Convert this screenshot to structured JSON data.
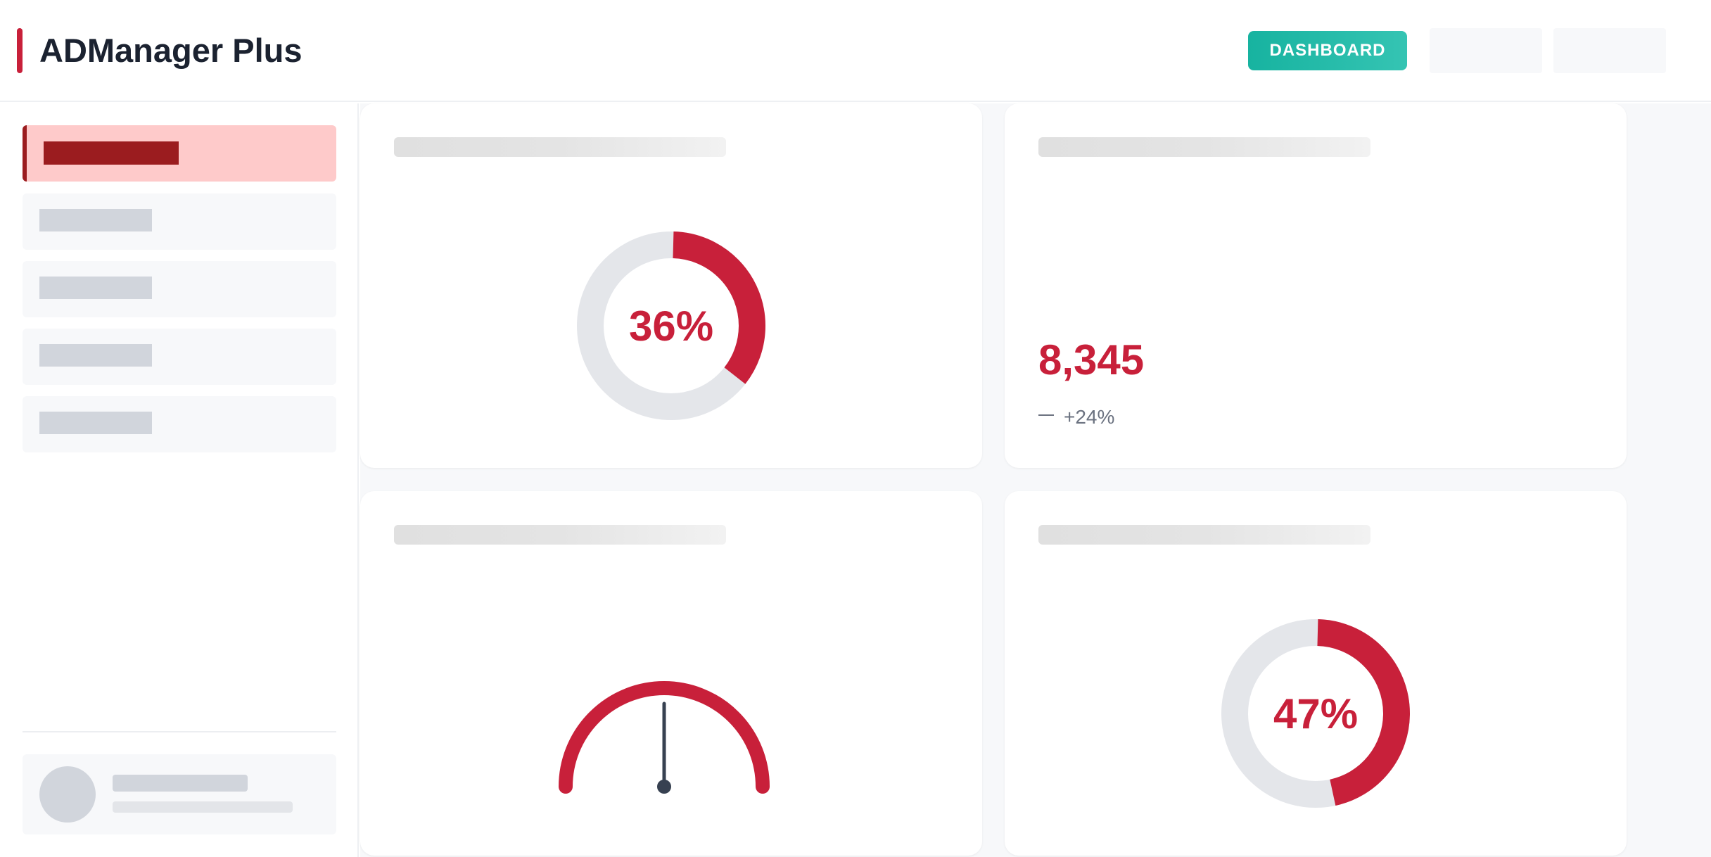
{
  "header": {
    "app_title": "ADManager Plus",
    "dashboard_button": "DASHBOARD"
  },
  "colors": {
    "accent": "#c8203a",
    "accent_dark": "#9b1c1f",
    "teal": "#17b3a0",
    "track": "#e4e6ea",
    "needle": "#374151"
  },
  "widgets": {
    "donut_one": {
      "label": "36%",
      "percent": 36
    },
    "stat": {
      "value": "8,345",
      "trend_text": "+24%",
      "trend_icon": "trend-flat-icon"
    },
    "gauge": {
      "value_fraction": 0.5
    },
    "donut_two": {
      "label": "47%",
      "percent": 47
    }
  }
}
